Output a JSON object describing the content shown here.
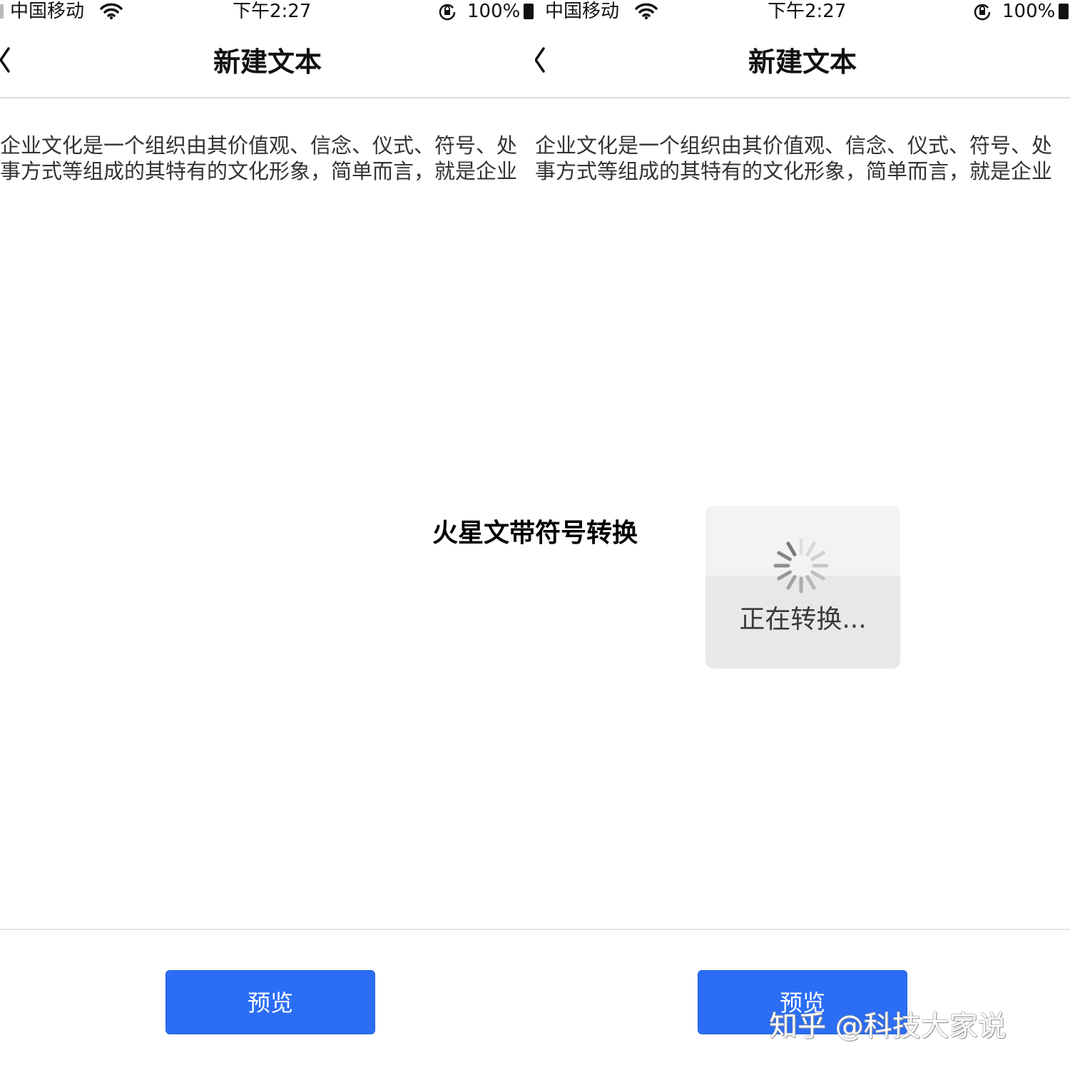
{
  "screens": [
    {
      "status_bar": {
        "carrier": "中国移动",
        "time": "下午2:27",
        "battery": "100%"
      },
      "nav_bar": {
        "title": "新建文本",
        "back_icon": "chevron-left-icon"
      },
      "content": {
        "lines": [
          "企业文化是一个组织由其价值观、信念、仪式、符号、处",
          "事方式等组成的其特有的文化形象，简单而言，就是企业"
        ]
      },
      "preview_button": "预览"
    },
    {
      "status_bar": {
        "carrier": "中国移动",
        "time": "下午2:27",
        "battery": "100%"
      },
      "nav_bar": {
        "title": "新建文本",
        "back_icon": "chevron-left-icon"
      },
      "content": {
        "lines": [
          "企业文化是一个组织由其价值观、信念、仪式、符号、处",
          "事方式等组成的其特有的文化形象，简单而言，就是企业"
        ]
      },
      "loading": {
        "text": "正在转换...",
        "icon": "spinner-icon"
      },
      "preview_button": "预览"
    }
  ],
  "overlay_caption": "火星文带符号转换",
  "watermark": "知乎 @科技大家说",
  "colors": {
    "primary_button": "#2b6ef5",
    "button_text": "#ffffff",
    "divider": "#dcdcdc",
    "toast_background": "#eeeeee"
  }
}
